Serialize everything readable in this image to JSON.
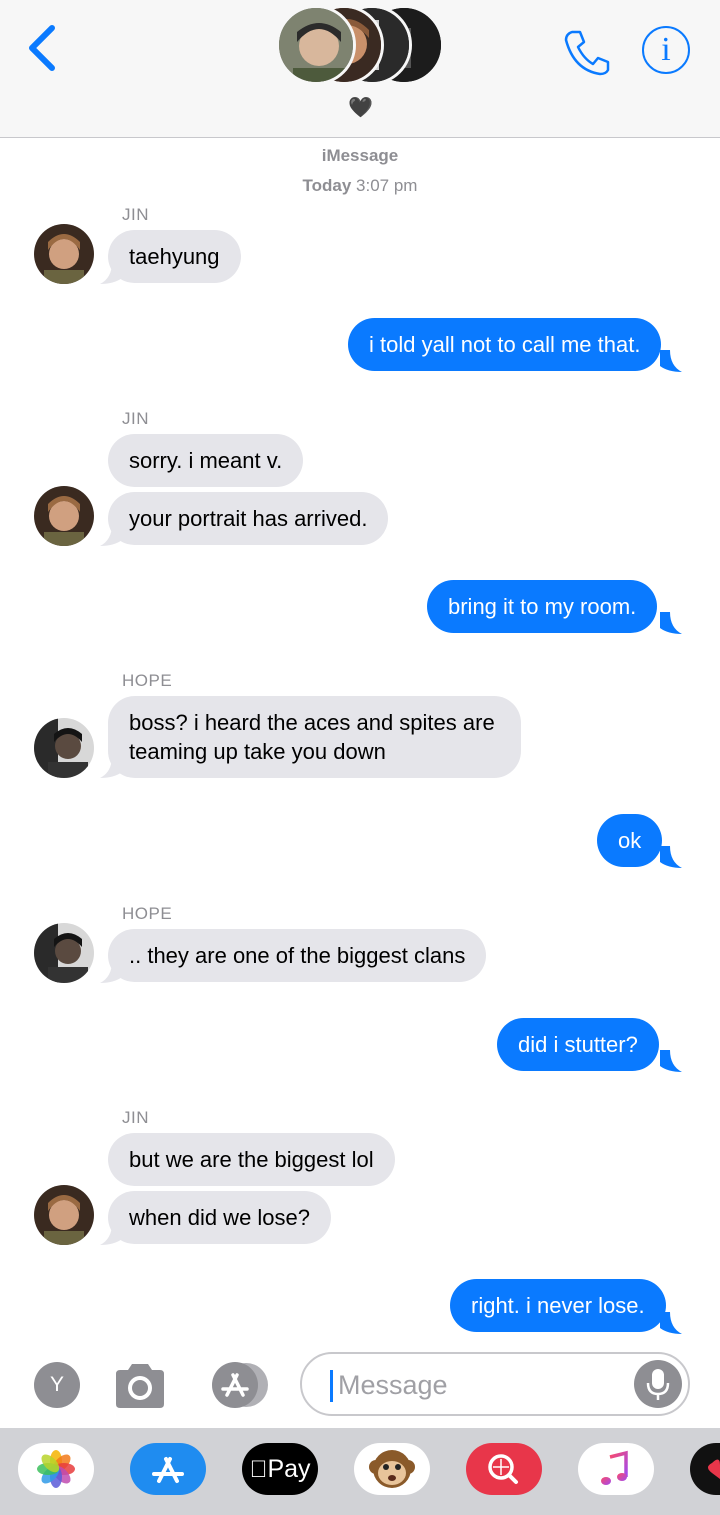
{
  "header": {
    "contact_emoji": "🖤",
    "colors": {
      "accent": "#0a7aff"
    }
  },
  "thread": {
    "service": "iMessage",
    "date_label": "Today",
    "time_label": "3:07 pm"
  },
  "messages": [
    {
      "sender": "JIN",
      "direction": "in",
      "text": "taehyung"
    },
    {
      "direction": "out",
      "text": "i told yall not to call me that."
    },
    {
      "sender": "JIN",
      "direction": "in",
      "text": "sorry. i meant v."
    },
    {
      "direction": "in",
      "text": "your portrait has arrived."
    },
    {
      "direction": "out",
      "text": "bring it to my room."
    },
    {
      "sender": "HOPE",
      "direction": "in",
      "text": "boss? i heard the aces and spites are"
    },
    {
      "direction": "in",
      "text": "teaming up take you down"
    },
    {
      "direction": "out",
      "text": "ok"
    },
    {
      "sender": "HOPE",
      "direction": "in",
      "text": ".. they are one of the biggest clans"
    },
    {
      "direction": "out",
      "text": "did i stutter?"
    },
    {
      "sender": "JIN",
      "direction": "in",
      "text": "but we are the biggest lol"
    },
    {
      "direction": "in",
      "text": "when did we lose?"
    },
    {
      "direction": "out",
      "text": "right. i never lose."
    }
  ],
  "composer": {
    "avatar_letter": "Y",
    "placeholder": "Message"
  },
  "app_drawer": {
    "apple_pay_label": "Pay",
    "icons": [
      "photos-icon",
      "app-store-icon",
      "apple-pay-icon",
      "animoji-monkey-icon",
      "search-images-icon",
      "music-icon",
      "heart-app-icon"
    ]
  }
}
